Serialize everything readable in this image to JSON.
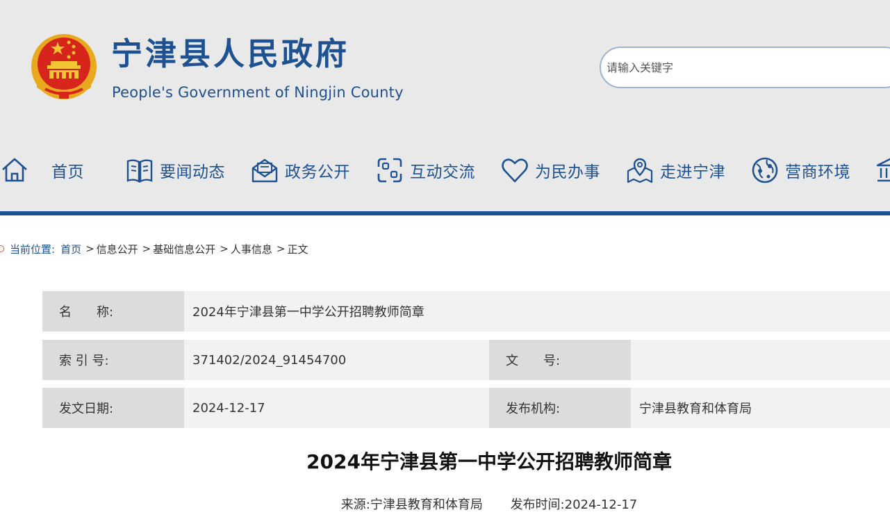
{
  "header": {
    "title": "宁津县人民政府",
    "subtitle": "People's Government of Ningjin County",
    "search_placeholder": "请输入关键字"
  },
  "nav": {
    "items": [
      {
        "label": "首页",
        "icon": "home-icon"
      },
      {
        "label": "要闻动态",
        "icon": "book-icon"
      },
      {
        "label": "政务公开",
        "icon": "mail-open-icon"
      },
      {
        "label": "互动交流",
        "icon": "interaction-icon"
      },
      {
        "label": "为民办事",
        "icon": "heart-icon"
      },
      {
        "label": "走进宁津",
        "icon": "map-pin-icon"
      },
      {
        "label": "营商环境",
        "icon": "globe-icon"
      },
      {
        "label": "",
        "icon": "building-icon"
      }
    ]
  },
  "breadcrumb": {
    "prefix": "当前位置:",
    "items": [
      "首页",
      "信息公开",
      "基础信息公开",
      "人事信息",
      "正文"
    ],
    "separator": ">"
  },
  "info": {
    "name_label": "名　　称:",
    "name_value": "2024年宁津县第一中学公开招聘教师简章",
    "index_label": "索 引 号:",
    "index_value": "371402/2024_91454700",
    "doc_no_label": "文　　号:",
    "doc_no_value": "",
    "date_label": "发文日期:",
    "date_value": "2024-12-17",
    "org_label": "发布机构:",
    "org_value": "宁津县教育和体育局"
  },
  "article": {
    "title": "2024年宁津县第一中学公开招聘教师简章",
    "source": "来源:宁津县教育和体育局",
    "publish_time": "发布时间:2024-12-17"
  },
  "colors": {
    "brand_blue": "#1d5192",
    "header_bg": "#e9e9ea",
    "emblem_red": "#d8251c",
    "emblem_gold": "#e9a91f"
  }
}
